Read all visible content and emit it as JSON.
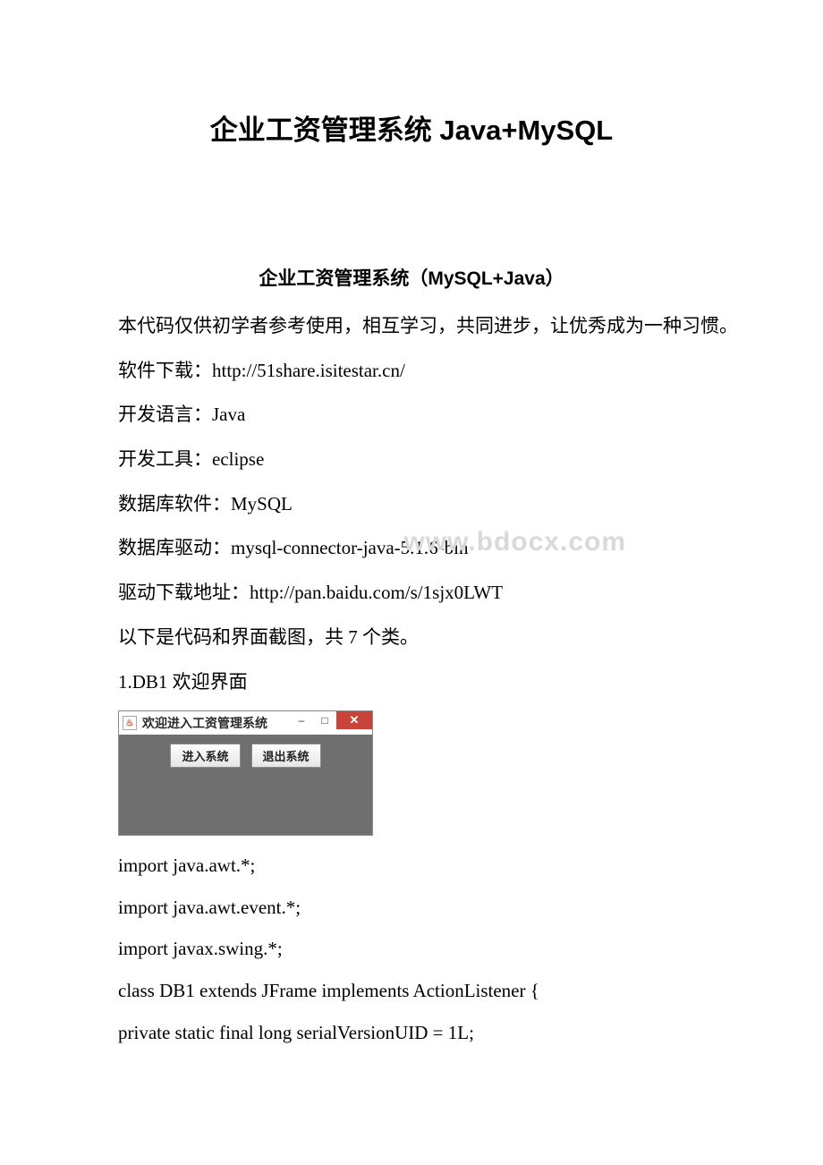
{
  "title": "企业工资管理系统 Java+MySQL",
  "subtitle": "企业工资管理系统（MySQL+Java）",
  "intro": "本代码仅供初学者参考使用，相互学习，共同进步，让优秀成为一种习惯。",
  "lines": {
    "download": "软件下载：http://51share.isitestar.cn/",
    "lang": "开发语言：Java",
    "tool": "开发工具：eclipse",
    "db": "数据库软件：MySQL",
    "driver": "数据库驱动：mysql-connector-java-5.1.6-bin",
    "driver_url": "驱动下载地址：http://pan.baidu.com/s/1sjx0LWT",
    "following": "以下是代码和界面截图，共 7 个类。",
    "section1": "1.DB1 欢迎界面"
  },
  "watermark": "www.bdocx.com",
  "window": {
    "title": "欢迎进入工资管理系统",
    "icon_text": "♨",
    "btn_enter": "进入系统",
    "btn_exit": "退出系统",
    "min": "–",
    "max": "□",
    "close": "✕"
  },
  "code": {
    "l1": "import java.awt.*;",
    "l2": "import java.awt.event.*;",
    "l3": "import javax.swing.*;",
    "l4": "class DB1 extends JFrame implements ActionListener {",
    "l5": " private static final long serialVersionUID = 1L;"
  }
}
